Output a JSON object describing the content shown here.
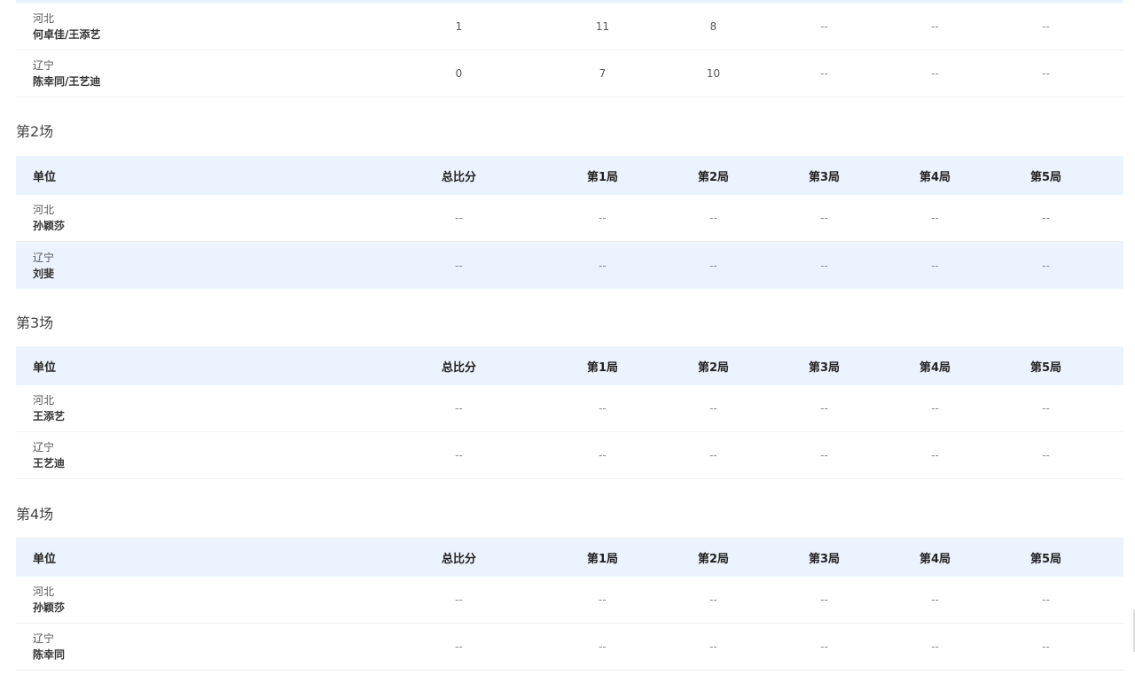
{
  "session1": {
    "rows": [
      {
        "unit": "河北",
        "players": "何卓佳/王添艺",
        "total": "1",
        "g1": "11",
        "g2": "8",
        "g3": "--",
        "g4": "--",
        "g5": "--"
      },
      {
        "unit": "辽宁",
        "players": "陈幸同/王艺迪",
        "total": "0",
        "g1": "7",
        "g2": "10",
        "g3": "--",
        "g4": "--",
        "g5": "--"
      }
    ]
  },
  "headers": {
    "unit": "单位",
    "total": "总比分",
    "g1": "第1局",
    "g2": "第2局",
    "g3": "第3局",
    "g4": "第4局",
    "g5": "第5局"
  },
  "session2": {
    "title": "第2场",
    "rows": [
      {
        "unit": "河北",
        "players": "孙颖莎",
        "total": "--",
        "g1": "--",
        "g2": "--",
        "g3": "--",
        "g4": "--",
        "g5": "--"
      },
      {
        "unit": "辽宁",
        "players": "刘斐",
        "total": "--",
        "g1": "--",
        "g2": "--",
        "g3": "--",
        "g4": "--",
        "g5": "--"
      }
    ]
  },
  "session3": {
    "title": "第3场",
    "rows": [
      {
        "unit": "河北",
        "players": "王添艺",
        "total": "--",
        "g1": "--",
        "g2": "--",
        "g3": "--",
        "g4": "--",
        "g5": "--"
      },
      {
        "unit": "辽宁",
        "players": "王艺迪",
        "total": "--",
        "g1": "--",
        "g2": "--",
        "g3": "--",
        "g4": "--",
        "g5": "--"
      }
    ]
  },
  "session4": {
    "title": "第4场",
    "rows": [
      {
        "unit": "河北",
        "players": "孙颖莎",
        "total": "--",
        "g1": "--",
        "g2": "--",
        "g3": "--",
        "g4": "--",
        "g5": "--"
      },
      {
        "unit": "辽宁",
        "players": "陈幸同",
        "total": "--",
        "g1": "--",
        "g2": "--",
        "g3": "--",
        "g4": "--",
        "g5": "--"
      }
    ]
  }
}
